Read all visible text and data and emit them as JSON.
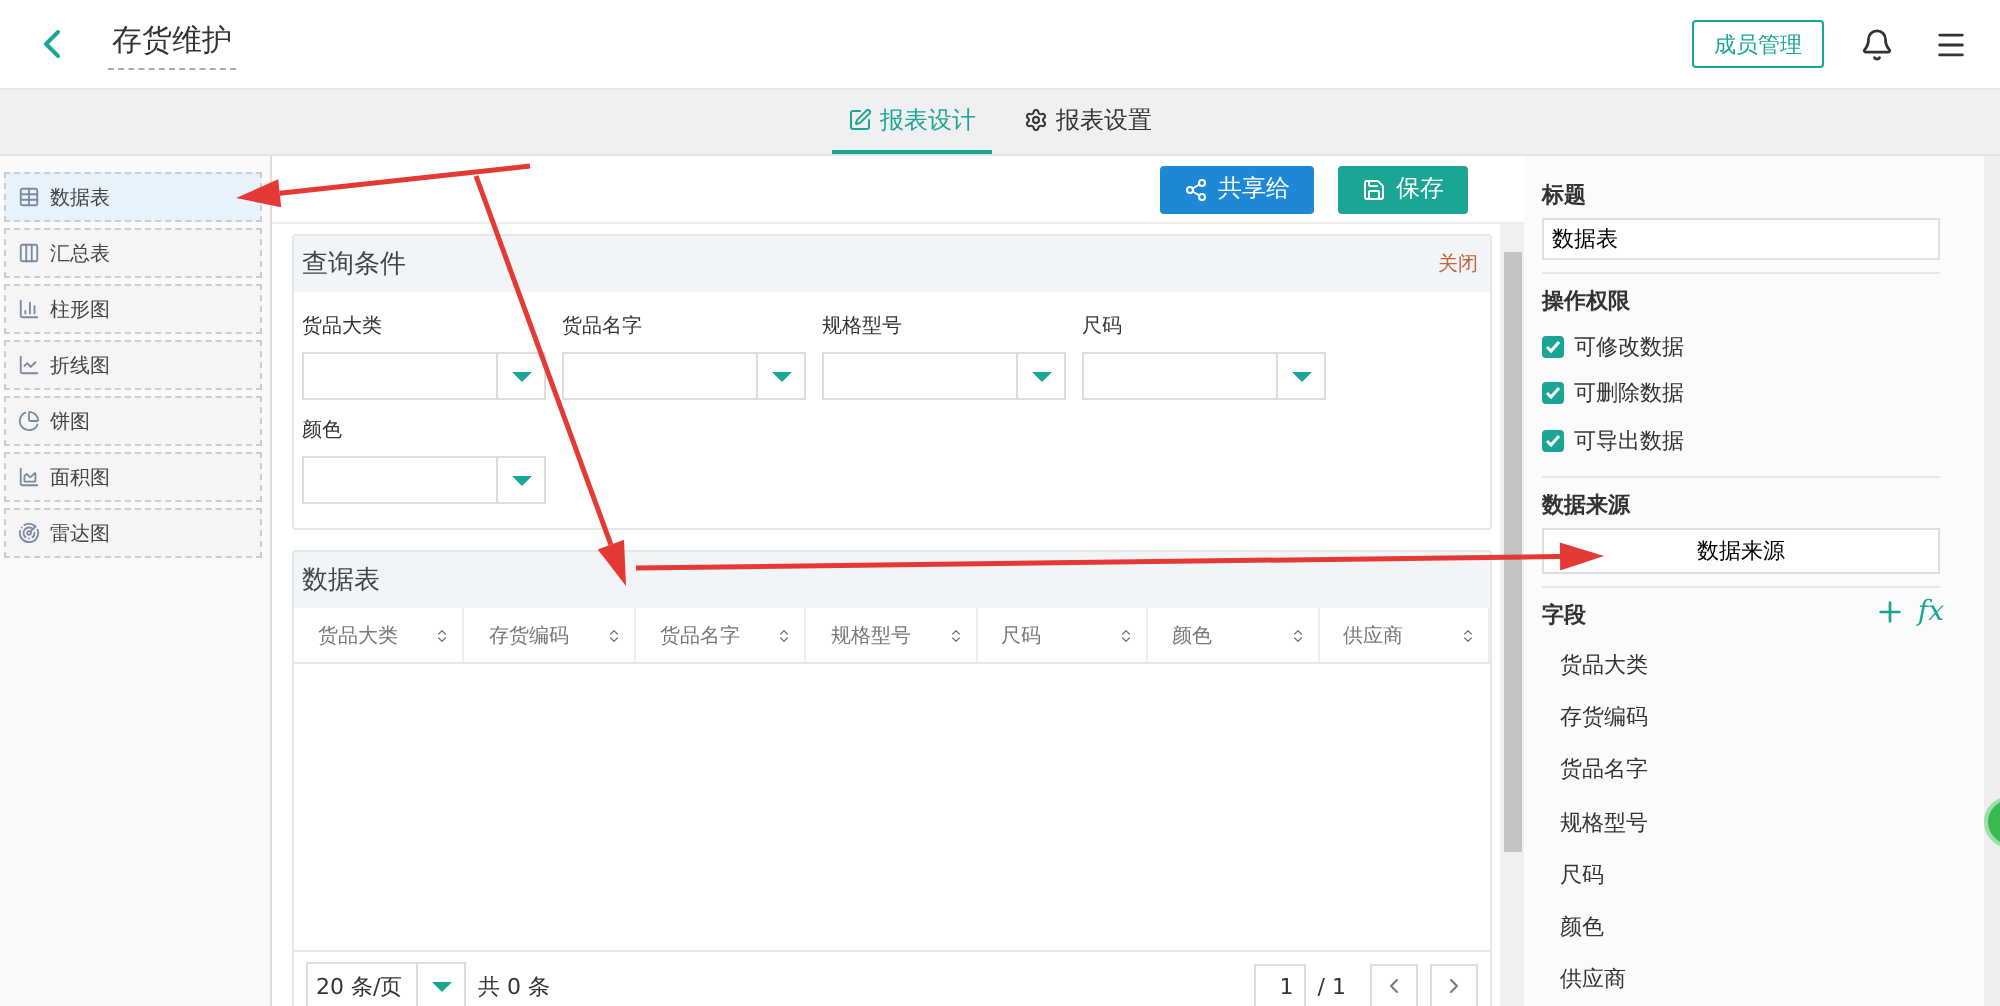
{
  "header": {
    "title": "存货维护",
    "member_button": "成员管理"
  },
  "tabs": [
    {
      "label": "报表设计",
      "kind": "design",
      "selected": true
    },
    {
      "label": "报表设置",
      "kind": "settings",
      "selected": false
    }
  ],
  "sidebar": {
    "items": [
      {
        "label": "数据表",
        "kind": "table",
        "selected": true
      },
      {
        "label": "汇总表",
        "kind": "summary",
        "selected": false
      },
      {
        "label": "柱形图",
        "kind": "bar",
        "selected": false
      },
      {
        "label": "折线图",
        "kind": "line",
        "selected": false
      },
      {
        "label": "饼图",
        "kind": "pie",
        "selected": false
      },
      {
        "label": "面积图",
        "kind": "area",
        "selected": false
      },
      {
        "label": "雷达图",
        "kind": "radar",
        "selected": false
      }
    ]
  },
  "toolbar": {
    "share": "共享给",
    "save": "保存"
  },
  "query_panel": {
    "title": "查询条件",
    "close": "关闭",
    "fields": [
      "货品大类",
      "货品名字",
      "规格型号",
      "尺码",
      "颜色"
    ]
  },
  "data_panel": {
    "title": "数据表",
    "columns": [
      "货品大类",
      "存货编码",
      "货品名字",
      "规格型号",
      "尺码",
      "颜色",
      "供应商"
    ],
    "page_size": "20 条/页",
    "total": "共 0 条",
    "page": "1",
    "pages": "/ 1"
  },
  "properties": {
    "title_label": "标题",
    "title_value": "数据表",
    "permissions_label": "操作权限",
    "permissions": [
      {
        "label": "可修改数据",
        "checked": true
      },
      {
        "label": "可删除数据",
        "checked": true
      },
      {
        "label": "可导出数据",
        "checked": true
      }
    ],
    "source_label": "数据来源",
    "source_button": "数据来源",
    "fields_label": "字段",
    "formula": "fx",
    "fields": [
      "货品大类",
      "存货编码",
      "货品名字",
      "规格型号",
      "尺码",
      "颜色",
      "供应商"
    ]
  }
}
